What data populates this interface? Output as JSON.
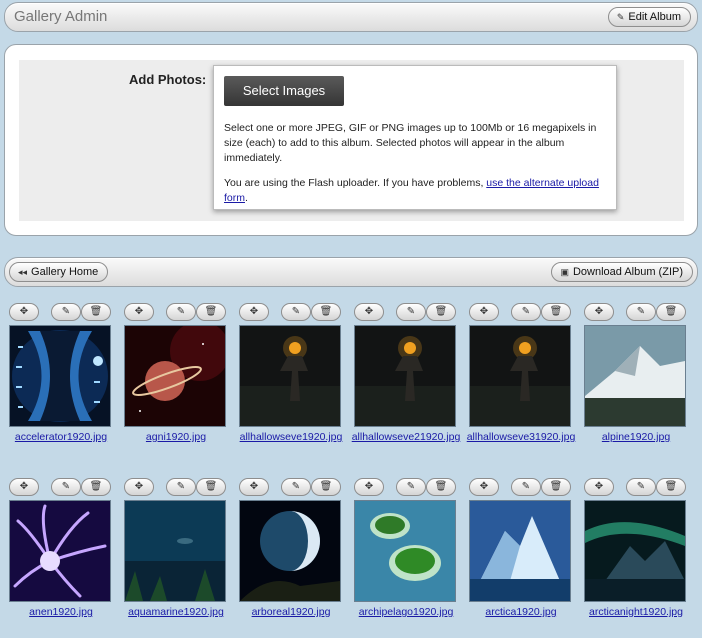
{
  "header": {
    "title": "Gallery Admin",
    "edit_album_label": "Edit Album"
  },
  "upload": {
    "label": "Add Photos:",
    "select_button": "Select Images",
    "description": "Select one or more JPEG, GIF or PNG images up to 100Mb or 16 megapixels in size (each) to add to this album. Selected photos will appear in the album immediately.",
    "flash_note": "You are using the Flash uploader. If you have problems, ",
    "alternate_link": "use the alternate upload form",
    "period": "."
  },
  "nav": {
    "gallery_home_label": "Gallery Home",
    "download_label": "Download Album (ZIP)"
  },
  "photos": [
    {
      "filename": "accelerator1920.jpg"
    },
    {
      "filename": "agni1920.jpg"
    },
    {
      "filename": "allhallowseve1920.jpg"
    },
    {
      "filename": "allhallowseve21920.jpg"
    },
    {
      "filename": "allhallowseve31920.jpg"
    },
    {
      "filename": "alpine1920.jpg"
    },
    {
      "filename": "anen1920.jpg"
    },
    {
      "filename": "aquamarine1920.jpg"
    },
    {
      "filename": "arboreal1920.jpg"
    },
    {
      "filename": "archipelago1920.jpg"
    },
    {
      "filename": "arctica1920.jpg"
    },
    {
      "filename": "arcticanight1920.jpg"
    }
  ],
  "icons": {
    "edit_album": "pencil-icon",
    "gallery_home": "double-left-arrow-icon",
    "download": "disk-icon",
    "photo_tools": [
      "move-icon",
      "edit-icon",
      "trash-icon"
    ]
  },
  "colors": {
    "background": "#c4d9e7",
    "link": "#1a1aa6",
    "button_dark": "#3f3f3f"
  }
}
